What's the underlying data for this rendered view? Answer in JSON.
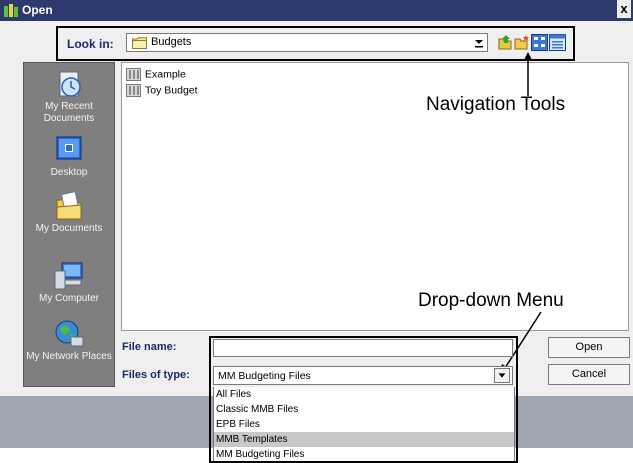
{
  "window": {
    "title": "Open",
    "close_glyph": "x"
  },
  "lookin": {
    "label": "Look in:",
    "value": "Budgets",
    "icons": [
      "up-folder-icon",
      "new-folder-icon",
      "list-view-icon",
      "details-view-icon"
    ]
  },
  "places": [
    {
      "label": "My Recent Documents",
      "icon": "recent-documents-icon"
    },
    {
      "label": "Desktop",
      "icon": "desktop-icon"
    },
    {
      "label": "My Documents",
      "icon": "my-documents-icon"
    },
    {
      "label": "My Computer",
      "icon": "my-computer-icon"
    },
    {
      "label": "My Network Places",
      "icon": "network-places-icon"
    }
  ],
  "files": [
    {
      "name": "Example",
      "icon": "budget-file-icon"
    },
    {
      "name": "Toy Budget",
      "icon": "budget-file-icon"
    }
  ],
  "annotations": {
    "nav_tools": "Navigation Tools",
    "dropdown": "Drop-down Menu"
  },
  "form": {
    "filename_label": "File name:",
    "filename_value": "",
    "filetype_label": "Files of type:",
    "filetype_value": "MM Budgeting Files",
    "filetype_options": [
      "All Files",
      "Classic MMB Files",
      "EPB Files",
      "MMB Templates",
      "MM Budgeting Files"
    ],
    "highlighted_option": "MMB Templates"
  },
  "buttons": {
    "open": "Open",
    "cancel": "Cancel"
  },
  "colors": {
    "titlebar": "#2e3a6e",
    "label_blue": "#1a2a6c",
    "places_bg": "#7f7f7f",
    "dialog_bg": "#efefef",
    "highlight": "#c8c8c8"
  }
}
